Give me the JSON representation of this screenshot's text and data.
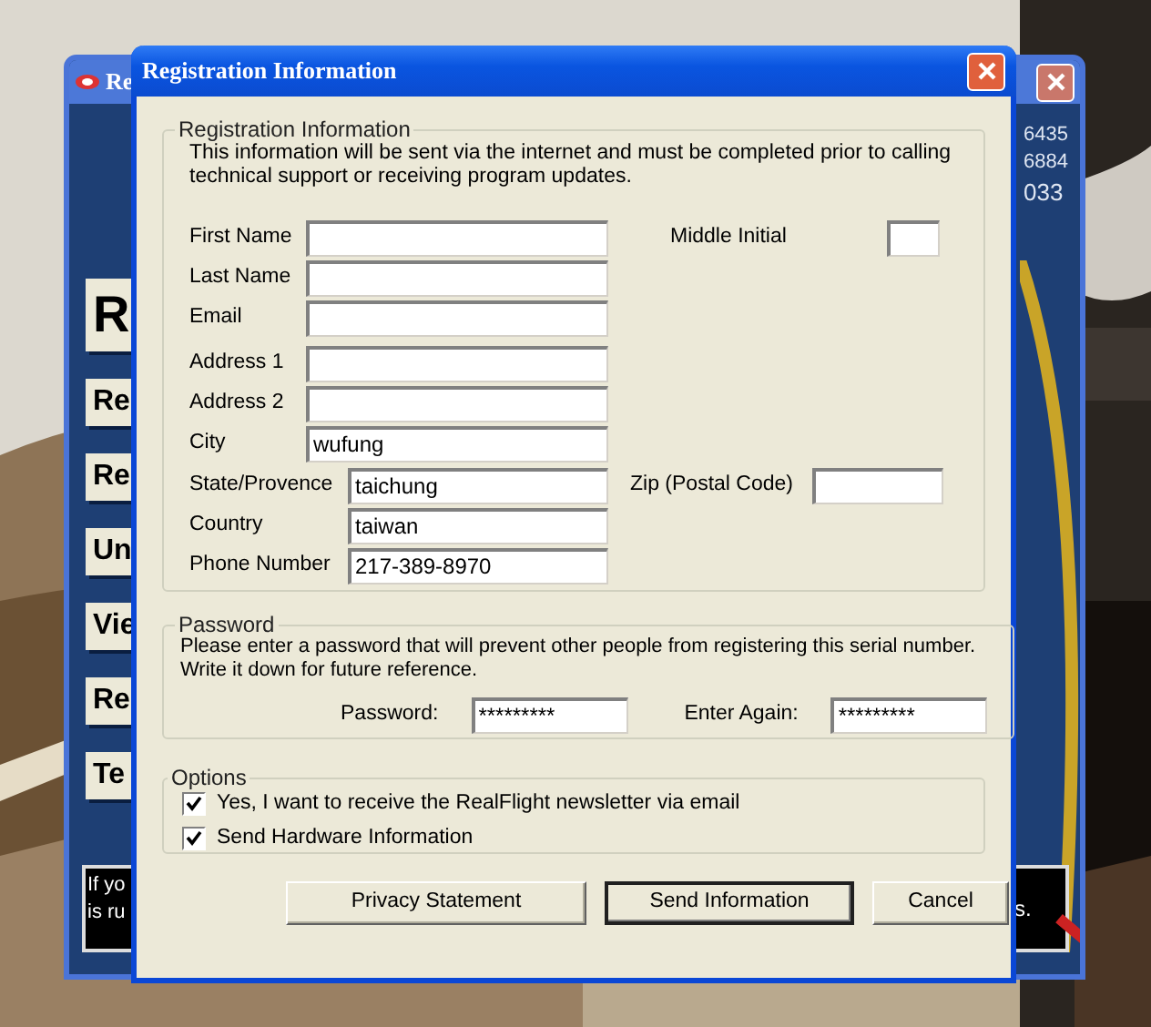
{
  "background_window": {
    "title": "Re",
    "left_buttons": [
      {
        "label": "R"
      },
      {
        "label": "Re"
      },
      {
        "label": "Re"
      },
      {
        "label": "Un"
      },
      {
        "label": "Vie"
      },
      {
        "label": "Re"
      },
      {
        "label": "Te"
      }
    ],
    "notice_left": [
      "If yo",
      "is ru"
    ],
    "numbers": [
      "6435",
      "6884",
      "033"
    ],
    "notice_right": "s."
  },
  "dialog": {
    "title": "Registration Information",
    "registration": {
      "title": "Registration Information",
      "description": "This information will be sent via the internet and must be completed prior to calling technical support or receiving program updates.",
      "rows": [
        {
          "label": "First Name",
          "extra": {
            "label": "Middle Initial"
          }
        },
        {
          "label": "Last Name"
        },
        {
          "label": "Email"
        },
        {
          "label": "Address 1"
        },
        {
          "label": "Address 2"
        },
        {
          "label": "City",
          "value": "wufung"
        },
        {
          "label": "State/Provence",
          "value": "taichung",
          "extra": {
            "label": "Zip (Postal Code)"
          }
        },
        {
          "label": "Country",
          "value": "taiwan"
        },
        {
          "label": "Phone Number",
          "value": "217-389-8970"
        }
      ]
    },
    "password": {
      "title": "Password",
      "description": "Please enter a password that will prevent other people from registering this serial number. Write it down for future reference.",
      "fields": [
        {
          "label": "Password:",
          "value": "*********"
        },
        {
          "label": "Enter Again:",
          "value": "*********"
        }
      ]
    },
    "options": {
      "title": "Options",
      "checkboxes": [
        {
          "label": "Yes, I want to receive the RealFlight newsletter via email",
          "checked": true
        },
        {
          "label": "Send Hardware Information",
          "checked": true
        }
      ]
    },
    "buttons": [
      {
        "label": "Privacy Statement",
        "default": false
      },
      {
        "label": "Send Information",
        "default": true
      },
      {
        "label": "Cancel",
        "default": false
      }
    ]
  }
}
